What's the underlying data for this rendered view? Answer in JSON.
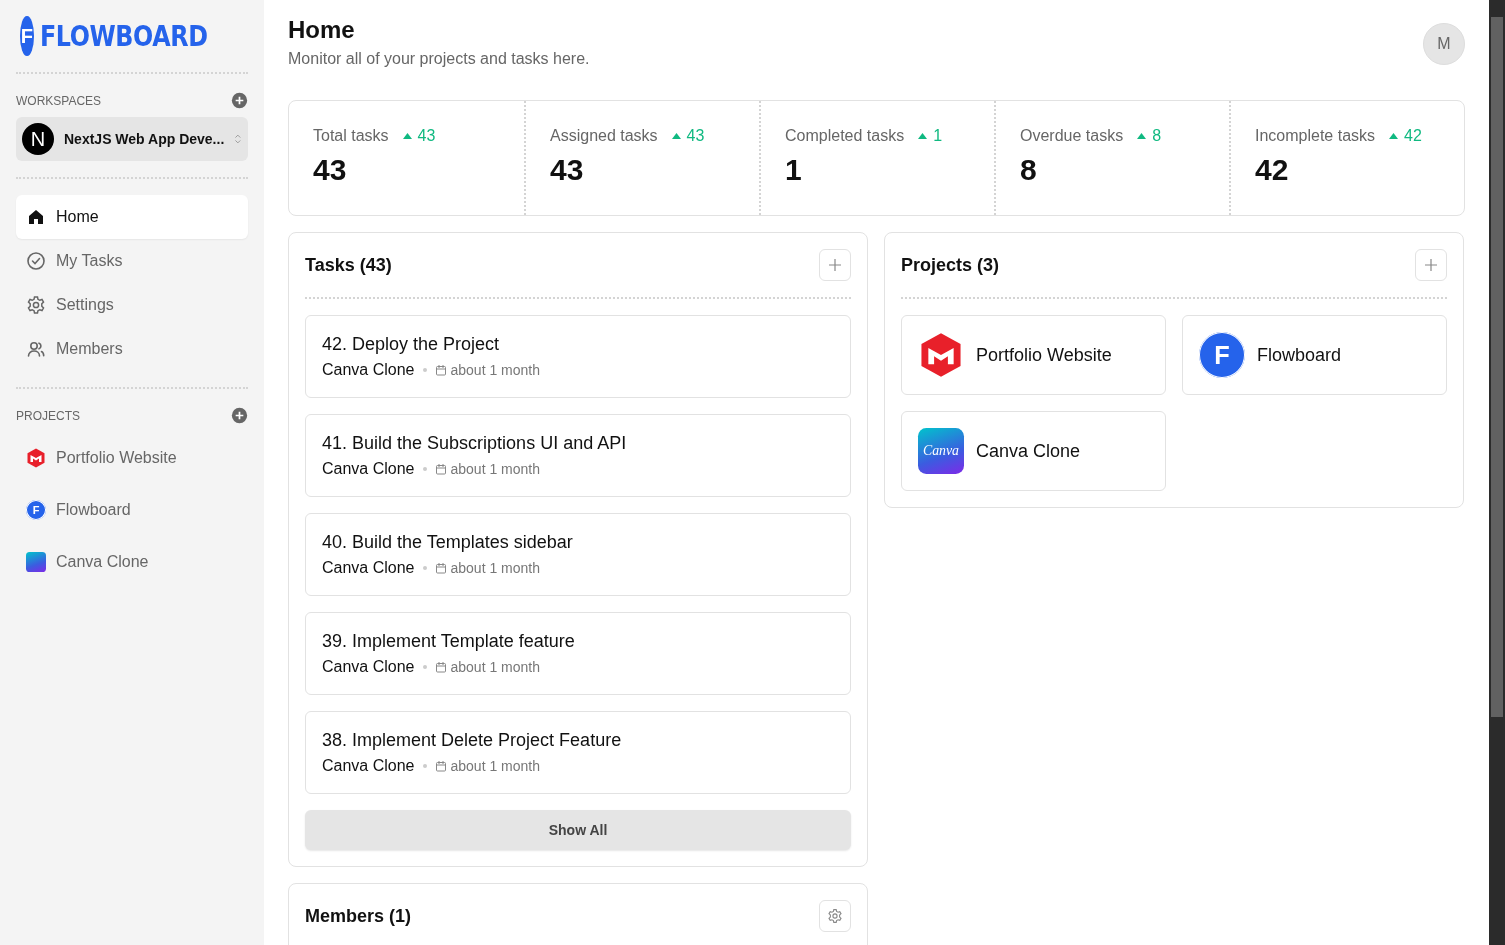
{
  "brand": {
    "logo_letter": "F",
    "name": "FLOWBOARD"
  },
  "workspaces": {
    "heading": "WORKSPACES",
    "current": {
      "letter": "N",
      "name": "NextJS Web App Deve..."
    }
  },
  "nav": [
    {
      "label": "Home",
      "kind": "home",
      "selected": true
    },
    {
      "label": "My Tasks",
      "kind": "tasks",
      "selected": false
    },
    {
      "label": "Settings",
      "kind": "settings",
      "selected": false
    },
    {
      "label": "Members",
      "kind": "members",
      "selected": false
    }
  ],
  "sidebar_projects": {
    "heading": "PROJECTS",
    "items": [
      {
        "name": "Portfolio Website",
        "kind": "portfolio"
      },
      {
        "name": "Flowboard",
        "kind": "flowboard",
        "icon_text": "F"
      },
      {
        "name": "Canva Clone",
        "kind": "canva"
      }
    ]
  },
  "header": {
    "title": "Home",
    "subtitle": "Monitor all of your projects and tasks here.",
    "avatar": "M"
  },
  "stats": [
    {
      "label": "Total tasks",
      "delta": "43",
      "value": "43"
    },
    {
      "label": "Assigned tasks",
      "delta": "43",
      "value": "43"
    },
    {
      "label": "Completed tasks",
      "delta": "1",
      "value": "1"
    },
    {
      "label": "Overdue tasks",
      "delta": "8",
      "value": "8"
    },
    {
      "label": "Incomplete tasks",
      "delta": "42",
      "value": "42"
    }
  ],
  "tasks": {
    "title": "Tasks (43)",
    "items": [
      {
        "title": "42. Deploy the Project",
        "project": "Canva Clone",
        "due": "about 1 month"
      },
      {
        "title": "41. Build the Subscriptions UI and API",
        "project": "Canva Clone",
        "due": "about 1 month"
      },
      {
        "title": "40. Build the Templates sidebar",
        "project": "Canva Clone",
        "due": "about 1 month"
      },
      {
        "title": "39. Implement Template feature",
        "project": "Canva Clone",
        "due": "about 1 month"
      },
      {
        "title": "38. Implement Delete Project Feature",
        "project": "Canva Clone",
        "due": "about 1 month"
      }
    ],
    "show_all": "Show All"
  },
  "projects": {
    "title": "Projects (3)",
    "items": [
      {
        "name": "Portfolio Website",
        "kind": "portfolio"
      },
      {
        "name": "Flowboard",
        "kind": "flowboard",
        "icon_text": "F"
      },
      {
        "name": "Canva Clone",
        "kind": "canva",
        "icon_text": "Canva"
      }
    ]
  },
  "members": {
    "title": "Members (1)"
  }
}
